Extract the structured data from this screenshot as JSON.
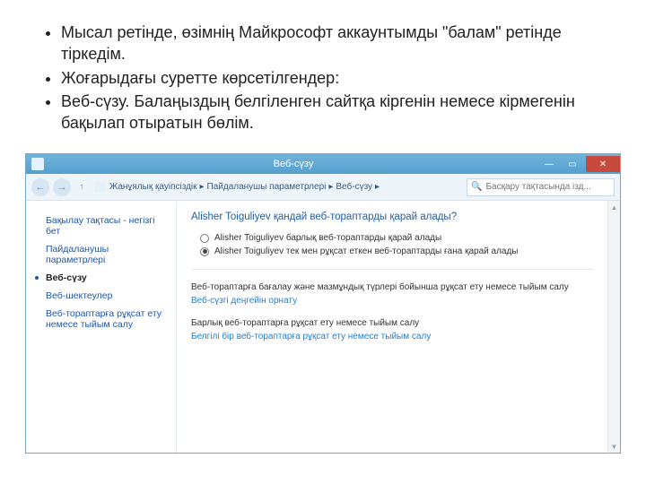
{
  "bullets": {
    "b1": "Мысал ретінде, өзімнің Майкрософт аккаунтымды \"балам\" ретінде тіркедім.",
    "b2": "Жоғарыдағы суретте көрсетілгендер:",
    "b3": "Веб-сүзу. Балаңыздың белгіленген сайтқа кіргенін немесе кірмегенін бақылап отыратын бөлім."
  },
  "window": {
    "title": "Веб-сүзу",
    "btn_min": "—",
    "btn_max": "▭",
    "btn_close": "✕"
  },
  "toolbar": {
    "back": "←",
    "forward": "→",
    "up": "↑",
    "sep": "▸",
    "crumb1": "Жанұялық қауіпсіздік",
    "crumb2": "Пайдаланушы параметрлері",
    "crumb3": "Веб-сүзу",
    "search_placeholder": "Басқару тақтасында ізд..."
  },
  "sidebar": {
    "s1": "Бақылау тақтасы - негізгі бет",
    "s2": "Пайдаланушы параметрлері",
    "s3": "Веб-сүзу",
    "s4": "Веб-шектеулер",
    "s5": "Веб-тораптарға рұқсат ету немесе тыйым салу"
  },
  "content": {
    "heading": "Alisher Toiguliyev қандай веб-тораптарды қарай алады?",
    "radio1": "Alisher Toiguliyev барлық веб-тораптарды қарай алады",
    "radio2": "Alisher Toiguliyev тек мен рұқсат еткен веб-тораптарды ғана қарай алады",
    "sec1_label": "Веб-тораптарға бағалау және мазмұндық түрлері бойынша рұқсат ету немесе тыйым салу",
    "sec1_link": "Веб-сүзгі деңгейін орнату",
    "sec2_label": "Барлық веб-тораптарға рұқсат ету немесе тыйым салу",
    "sec2_link": "Белгілі бір веб-тораптарға рұқсат ету немесе тыйым салу"
  }
}
